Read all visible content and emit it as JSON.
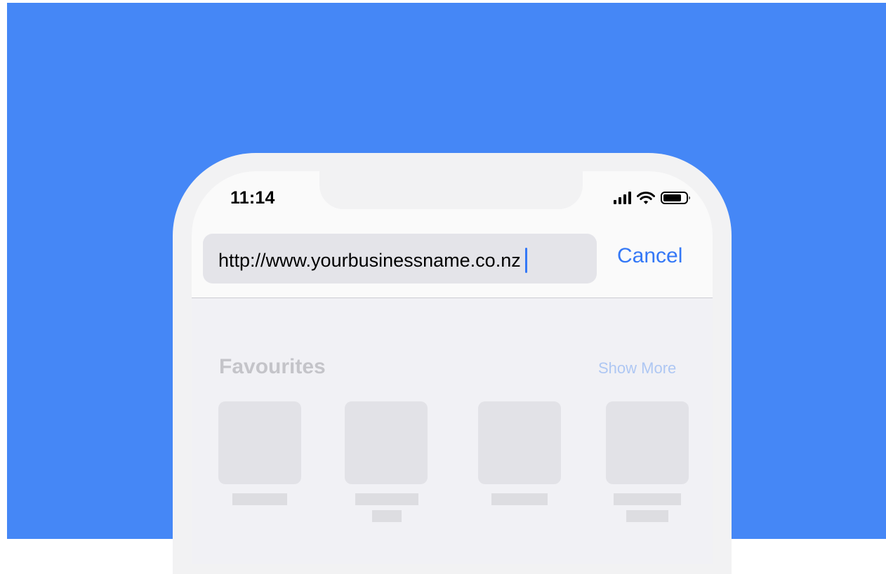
{
  "status_bar": {
    "time": "11:14",
    "icons": [
      "cellular-signal-icon",
      "wifi-icon",
      "battery-icon"
    ]
  },
  "address_bar": {
    "url": "http://www.yourbusinessname.co.nz",
    "cancel_label": "Cancel"
  },
  "favourites": {
    "title": "Favourites",
    "show_more_label": "Show More",
    "items": [
      {
        "label_lines": 1
      },
      {
        "label_lines": 2
      },
      {
        "label_lines": 1
      },
      {
        "label_lines": 2
      }
    ]
  },
  "colors": {
    "background": "#4587f6",
    "accent": "#3478f6",
    "device_frame": "#f2f2f3"
  }
}
